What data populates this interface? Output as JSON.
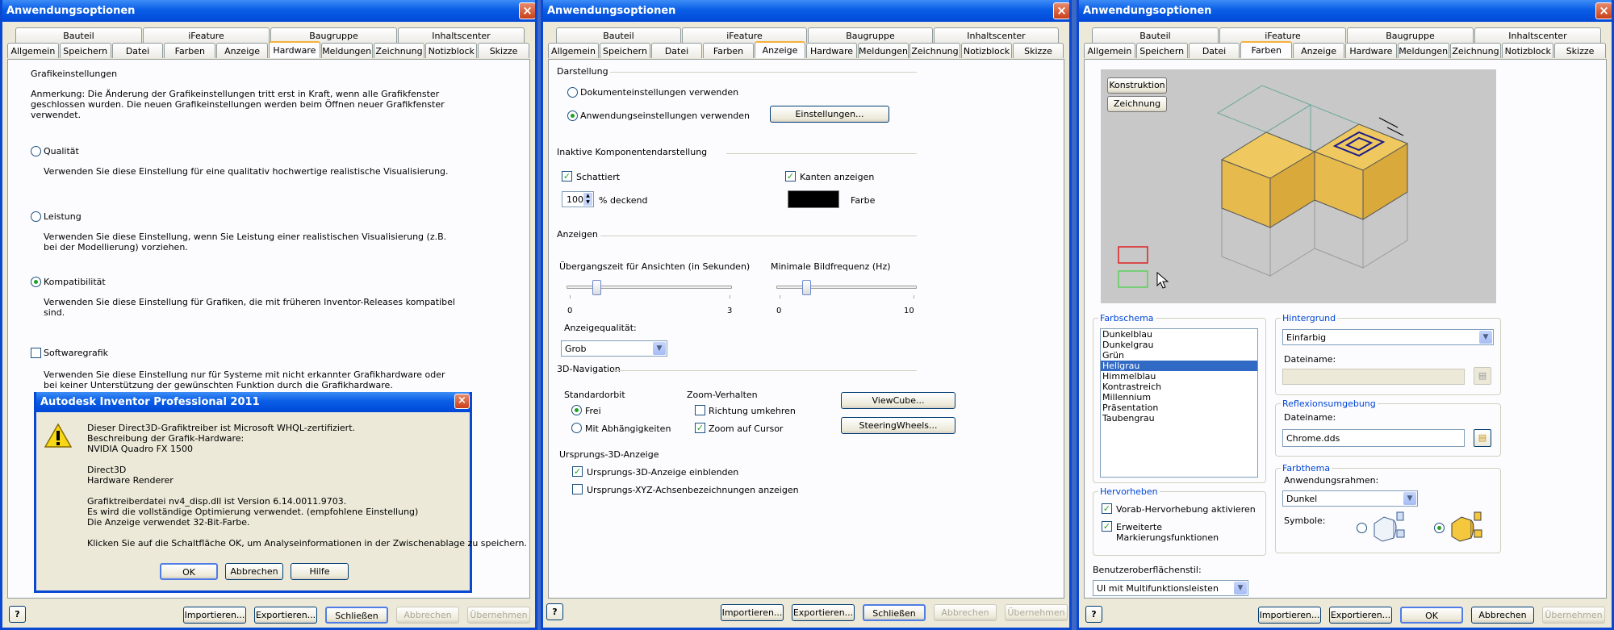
{
  "win1": {
    "title": "Anwendungsoptionen",
    "tabs_top": [
      "Bauteil",
      "iFeature",
      "Baugruppe",
      "Inhaltscenter"
    ],
    "tabs_bottom": [
      "Allgemein",
      "Speichern",
      "Datei",
      "Farben",
      "Anzeige",
      "Hardware",
      "Meldungen",
      "Zeichnung",
      "Notizblock",
      "Skizze"
    ],
    "selected_tab": "Hardware",
    "heading": "Grafikeinstellungen",
    "note_lines": [
      "Anmerkung: Die Änderung der Grafikeinstellungen tritt erst in Kraft, wenn alle Grafikfenster",
      "geschlossen wurden. Die neuen Grafikeinstellungen werden beim Öffnen neuer Grafikfenster",
      "verwendet."
    ],
    "opt_quality": "Qualität",
    "opt_quality_desc": "Verwenden Sie diese Einstellung für eine qualitativ hochwertige realistische Visualisierung.",
    "opt_perf": "Leistung",
    "opt_perf_desc": [
      "Verwenden Sie diese Einstellung, wenn Sie Leistung einer realistischen Visualisierung (z.B.",
      "bei der Modellierung) vorziehen."
    ],
    "opt_compat": "Kompatibilität",
    "opt_compat_desc": [
      "Verwenden Sie diese Einstellung für Grafiken, die mit früheren Inventor-Releases kompatibel",
      "sind."
    ],
    "opt_soft": "Softwaregrafik",
    "opt_soft_desc": [
      "Verwenden Sie diese Einstellung nur für Systeme mit nicht erkannter Grafikhardware oder",
      "bei keiner Unterstützung der gewünschten Funktion durch die Grafikhardware."
    ],
    "buttons": {
      "help": "?",
      "import": "Importieren...",
      "export": "Exportieren...",
      "close": "Schließen",
      "cancel": "Abbrechen",
      "apply": "Übernehmen"
    }
  },
  "dialog": {
    "title": "Autodesk Inventor Professional 2011",
    "lines": [
      "Dieser Direct3D-Grafiktreiber ist Microsoft WHQL-zertifiziert.",
      "Beschreibung der Grafik-Hardware:",
      "NVIDIA Quadro FX 1500",
      "",
      "Direct3D",
      "Hardware Renderer",
      "",
      "Grafiktreiberdatei nv4_disp.dll ist Version 6.14.0011.9703.",
      "Es wird die vollständige Optimierung verwendet.  (empfohlene Einstellung)",
      "Die Anzeige verwendet 32-Bit-Farbe.",
      "",
      "Klicken Sie auf die Schaltfläche OK, um Analyseinformationen in der Zwischenablage zu speichern."
    ],
    "ok": "OK",
    "cancel": "Abbrechen",
    "help": "Hilfe"
  },
  "win2": {
    "title": "Anwendungsoptionen",
    "tabs_top": [
      "Bauteil",
      "iFeature",
      "Baugruppe",
      "Inhaltscenter"
    ],
    "tabs_bottom": [
      "Allgemein",
      "Speichern",
      "Datei",
      "Farben",
      "Anzeige",
      "Hardware",
      "Meldungen",
      "Zeichnung",
      "Notizblock",
      "Skizze"
    ],
    "selected_tab": "Anzeige",
    "sec_darstellung": "Darstellung",
    "doc_settings": "Dokumenteinstellungen verwenden",
    "app_settings": "Anwendungseinstellungen verwenden",
    "einstellungen_btn": "Einstellungen...",
    "sec_inactive": "Inaktive Komponentendarstellung",
    "shaded": "Schattiert",
    "show_edges": "Kanten anzeigen",
    "opacity_value": "100",
    "opacity_label": "% deckend",
    "color_label": "Farbe",
    "sec_anzeigen": "Anzeigen",
    "transition_label": "Übergangszeit für Ansichten (in Sekunden)",
    "transition_min": "0",
    "transition_max": "3",
    "transition_value": 0.5,
    "framerate_label": "Minimale Bildfrequenz (Hz)",
    "framerate_min": "0",
    "framerate_max": "10",
    "framerate_value": 2,
    "quality_label": "Anzeigequalität:",
    "quality_value": "Grob",
    "sec_nav": "3D-Navigation",
    "orbit_label": "Standardorbit",
    "orbit_free": "Frei",
    "orbit_dep": "Mit Abhängigkeiten",
    "zoom_label": "Zoom-Verhalten",
    "zoom_reverse": "Richtung umkehren",
    "zoom_cursor": "Zoom auf Cursor",
    "viewcube_btn": "ViewCube...",
    "steering_btn": "SteeringWheels...",
    "origin_label": "Ursprungs-3D-Anzeige",
    "origin_show": "Ursprungs-3D-Anzeige einblenden",
    "origin_xyz": "Ursprungs-XYZ-Achsenbezeichnungen anzeigen",
    "buttons": {
      "help": "?",
      "import": "Importieren...",
      "export": "Exportieren...",
      "close": "Schließen",
      "cancel": "Abbrechen",
      "apply": "Übernehmen"
    }
  },
  "win3": {
    "title": "Anwendungsoptionen",
    "tabs_top": [
      "Bauteil",
      "iFeature",
      "Baugruppe",
      "Inhaltscenter"
    ],
    "tabs_bottom": [
      "Allgemein",
      "Speichern",
      "Datei",
      "Farben",
      "Anzeige",
      "Hardware",
      "Meldungen",
      "Zeichnung",
      "Notizblock",
      "Skizze"
    ],
    "selected_tab": "Farben",
    "preview_btn1": "Konstruktion",
    "preview_btn2": "Zeichnung",
    "scheme_label": "Farbschema",
    "schemes": [
      "Dunkelblau",
      "Dunkelgrau",
      "Grün",
      "Hellgrau",
      "Himmelblau",
      "Kontrastreich",
      "Millennium",
      "Präsentation",
      "Taubengrau"
    ],
    "selected_scheme": "Hellgrau",
    "bg_label": "Hintergrund",
    "bg_value": "Einfarbig",
    "filename_label": "Dateiname:",
    "filename_value": "",
    "refl_label": "Reflexionsumgebung",
    "refl_filename_label": "Dateiname:",
    "refl_filename_value": "Chrome.dds",
    "highlight_label": "Hervorheben",
    "hl_pre": "Vorab-Hervorhebung aktivieren",
    "hl_ext1": "Erweiterte",
    "hl_ext2": "Markierungsfunktionen",
    "theme_label": "Farbthema",
    "frame_label": "Anwendungsrahmen:",
    "frame_value": "Dunkel",
    "symbols_label": "Symbole:",
    "ui_style_label": "Benutzeroberflächenstil:",
    "ui_style_value": "UI mit Multifunktionsleisten",
    "buttons": {
      "help": "?",
      "import": "Importieren...",
      "export": "Exportieren...",
      "ok": "OK",
      "cancel": "Abbrechen",
      "apply": "Übernehmen"
    }
  },
  "colors": {
    "titlebar": "#0a5ee6",
    "face": "#ece9d8",
    "cube": "#e7ba4e",
    "preview_bg": "#c8c8c8",
    "edge_color": "#000000"
  }
}
